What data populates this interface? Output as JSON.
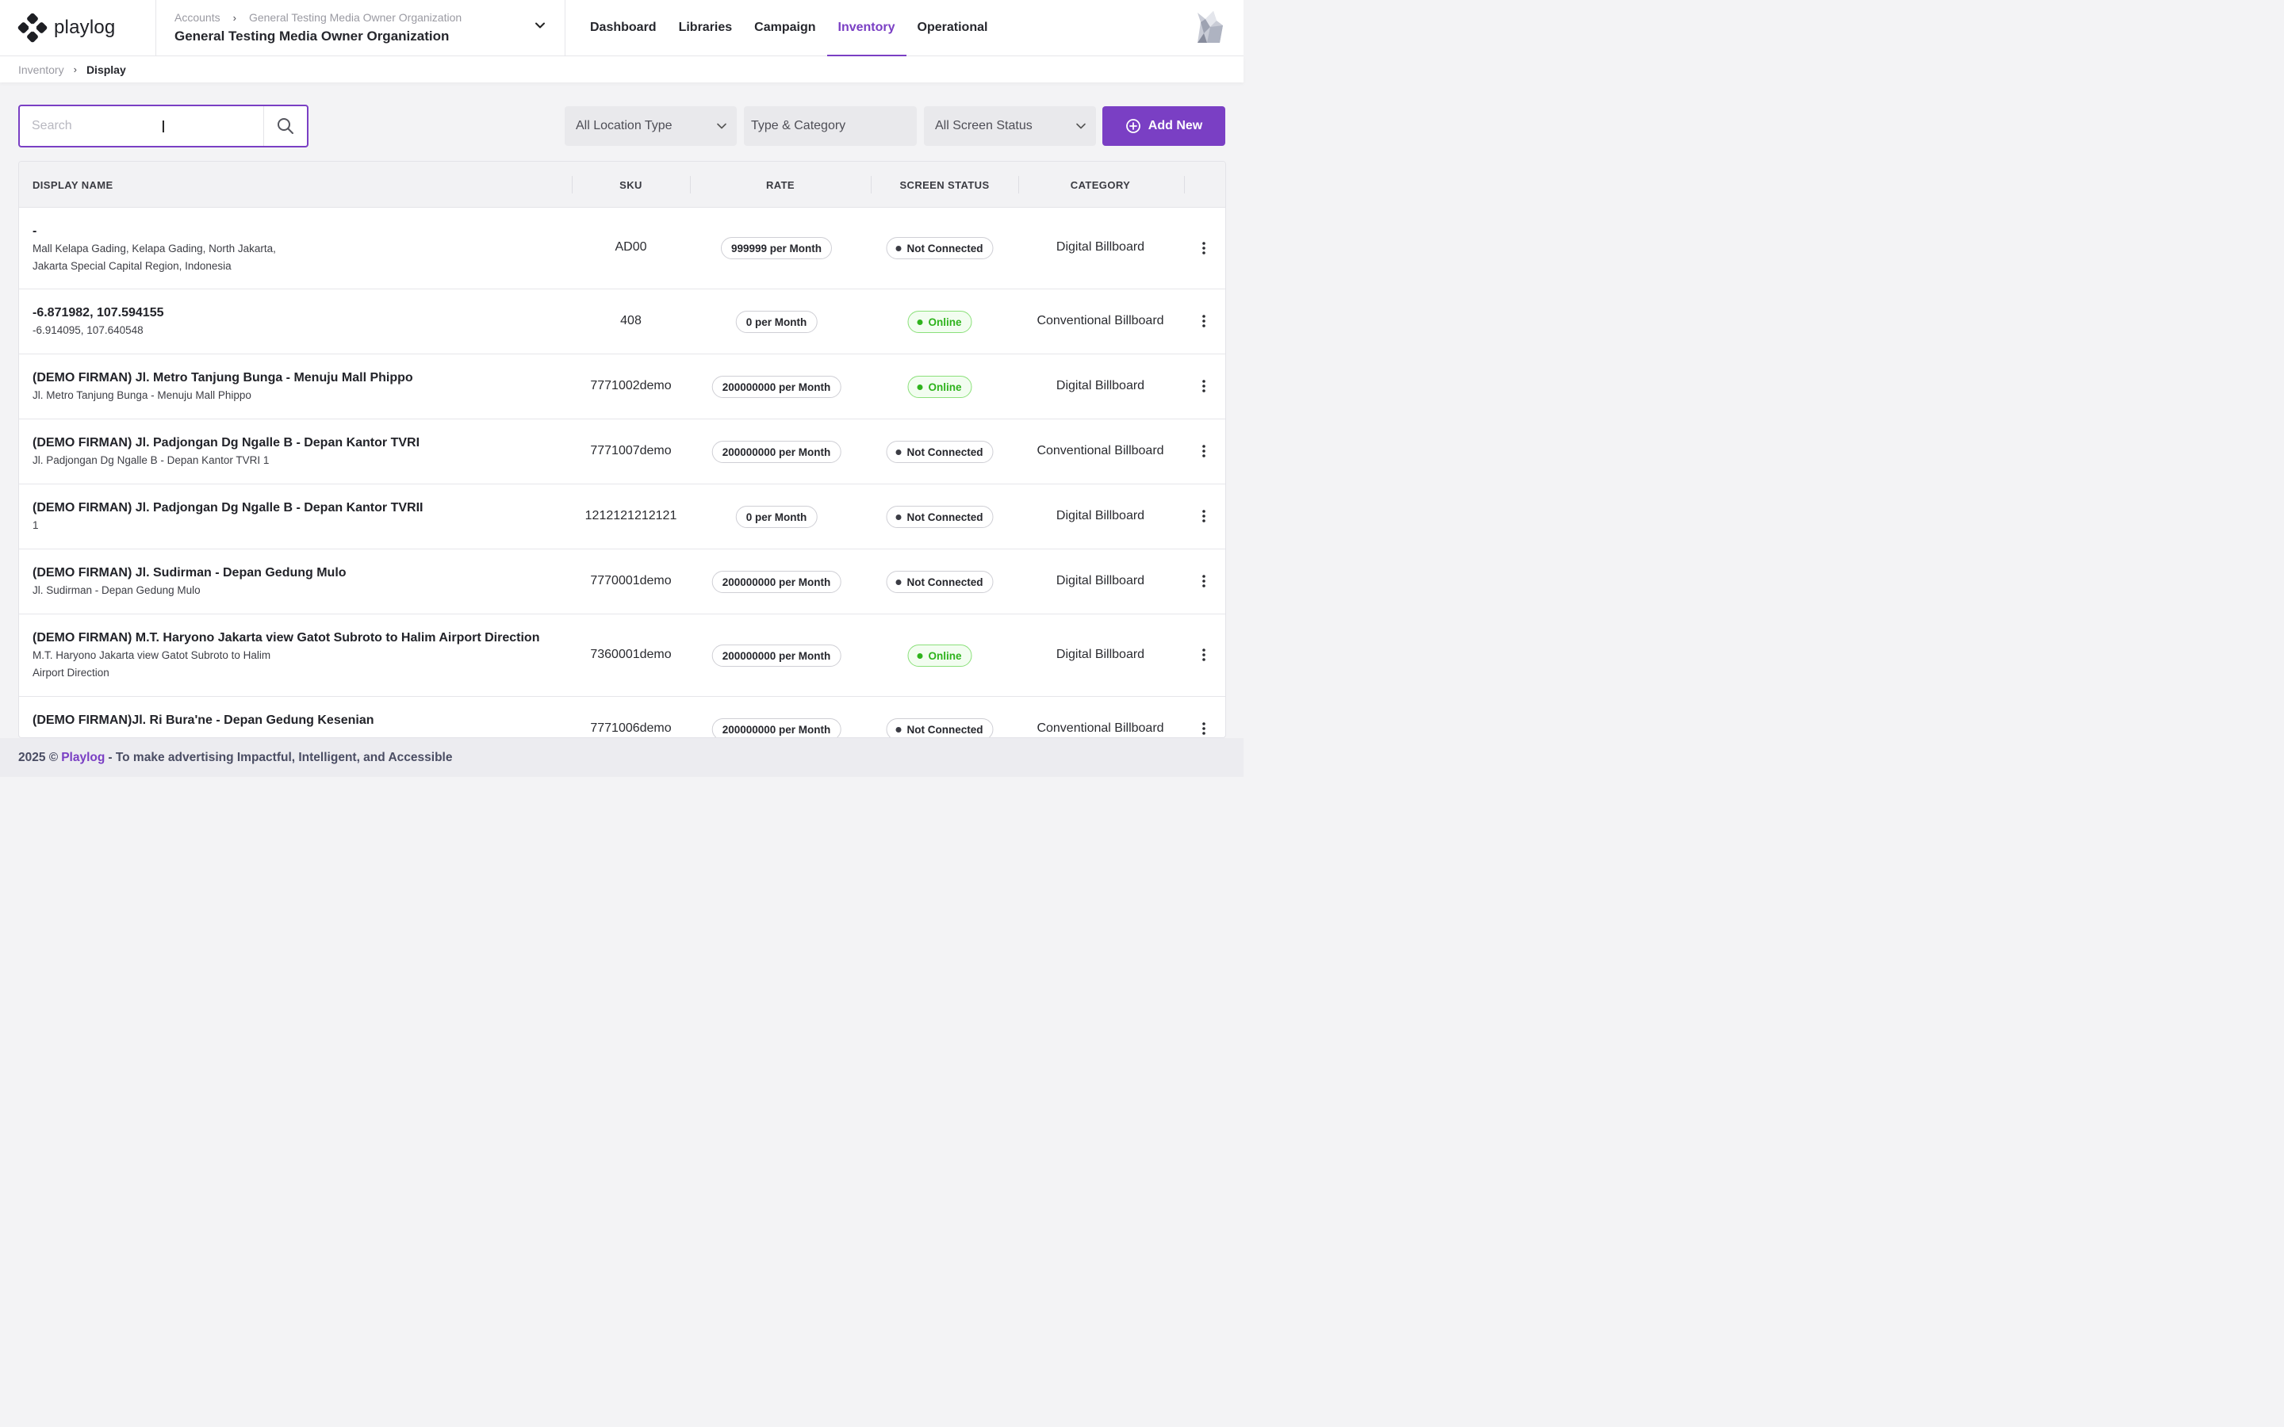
{
  "brand": {
    "name": "playlog"
  },
  "org_switcher": {
    "crumb_root": "Accounts",
    "crumb_org": "General Testing Media Owner Organization",
    "current_org": "General Testing Media Owner Organization"
  },
  "nav": [
    {
      "label": "Dashboard",
      "active": false
    },
    {
      "label": "Libraries",
      "active": false
    },
    {
      "label": "Campaign",
      "active": false
    },
    {
      "label": "Inventory",
      "active": true
    },
    {
      "label": "Operational",
      "active": false
    }
  ],
  "breadcrumb": {
    "parent": "Inventory",
    "current": "Display"
  },
  "search": {
    "placeholder": "Search",
    "value": ""
  },
  "filters": {
    "location_type": "All Location Type",
    "type_category": "Type & Category",
    "screen_status": "All Screen Status"
  },
  "add_button": {
    "label": "Add New"
  },
  "table": {
    "headers": {
      "display_name": "DISPLAY NAME",
      "sku": "SKU",
      "rate": "RATE",
      "screen_status": "SCREEN STATUS",
      "category": "CATEGORY"
    },
    "rows": [
      {
        "title": "-",
        "sub": [
          "Mall Kelapa Gading, Kelapa Gading, North Jakarta,",
          "Jakarta Special Capital Region, Indonesia"
        ],
        "sku": "AD00",
        "rate": "999999 per Month",
        "status": "Not Connected",
        "status_kind": "off",
        "category": "Digital Billboard"
      },
      {
        "title": "-6.871982, 107.594155",
        "sub": [
          "-6.914095, 107.640548"
        ],
        "sku": "408",
        "rate": "0 per Month",
        "status": "Online",
        "status_kind": "on",
        "category": "Conventional Billboard"
      },
      {
        "title": "(DEMO FIRMAN) Jl. Metro Tanjung Bunga - Menuju Mall Phippo",
        "sub": [
          "Jl. Metro Tanjung Bunga - Menuju Mall Phippo"
        ],
        "sku": "7771002demo",
        "rate": "200000000 per Month",
        "status": "Online",
        "status_kind": "on",
        "category": "Digital Billboard"
      },
      {
        "title": "(DEMO FIRMAN) Jl. Padjongan Dg Ngalle B - Depan Kantor TVRI",
        "sub": [
          "Jl. Padjongan Dg Ngalle B - Depan Kantor TVRI 1"
        ],
        "sku": "7771007demo",
        "rate": "200000000 per Month",
        "status": "Not Connected",
        "status_kind": "off",
        "category": "Conventional Billboard"
      },
      {
        "title": "(DEMO FIRMAN) Jl. Padjongan Dg Ngalle B - Depan Kantor TVRII",
        "sub": [
          "1"
        ],
        "sku": "1212121212121",
        "rate": "0 per Month",
        "status": "Not Connected",
        "status_kind": "off",
        "category": "Digital Billboard"
      },
      {
        "title": "(DEMO FIRMAN) Jl. Sudirman - Depan Gedung Mulo",
        "sub": [
          "Jl. Sudirman - Depan Gedung Mulo"
        ],
        "sku": "7770001demo",
        "rate": "200000000 per Month",
        "status": "Not Connected",
        "status_kind": "off",
        "category": "Digital Billboard"
      },
      {
        "title": "(DEMO FIRMAN) M.T. Haryono Jakarta view Gatot Subroto to Halim Airport Direction",
        "sub": [
          "M.T. Haryono Jakarta view Gatot Subroto to Halim",
          "Airport Direction"
        ],
        "sku": "7360001demo",
        "rate": "200000000 per Month",
        "status": "Online",
        "status_kind": "on",
        "category": "Digital Billboard"
      },
      {
        "title": "(DEMO FIRMAN)Jl. Ri Bura'ne - Depan Gedung Kesenian",
        "sub": [],
        "sku": "7771006demo",
        "rate": "200000000 per Month",
        "status": "Not Connected",
        "status_kind": "off",
        "category": "Conventional Billboard"
      }
    ]
  },
  "footer": {
    "year": "2025 ©",
    "brand": "Playlog",
    "tagline": "- To make advertising Impactful, Intelligent, and Accessible"
  },
  "colors": {
    "accent": "#7a3fc4",
    "online": "#2fb31d",
    "footer_text": "#4a4d63"
  }
}
